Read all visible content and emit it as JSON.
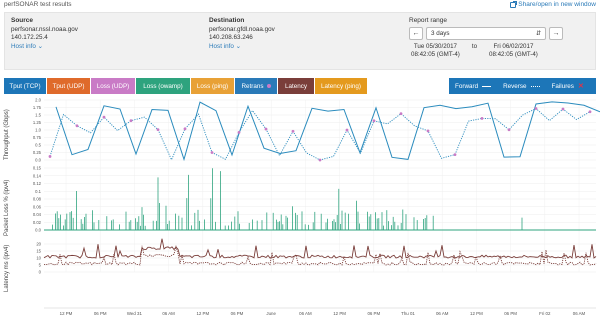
{
  "header": {
    "title": "perfSONAR test results",
    "share_label": "Share/open in new window"
  },
  "source": {
    "heading": "Source",
    "hostname": "perfsonar.nssl.noaa.gov",
    "ip": "140.172.25.4",
    "info_link": "Host info ⌄"
  },
  "destination": {
    "heading": "Destination",
    "hostname": "perfsonar.gfdl.noaa.gov",
    "ip": "140.208.63.246",
    "info_link": "Host info ⌄"
  },
  "report_range": {
    "heading": "Report range",
    "selected": "3 days",
    "prev_icon": "arrow-left-icon",
    "next_icon": "arrow-right-icon",
    "start_line1": "Tue 05/30/2017",
    "start_line2": "08:42:05 (GMT-4)",
    "to_label": "to",
    "end_line1": "Fri 06/02/2017",
    "end_line2": "08:42:05 (GMT-4)"
  },
  "legend": {
    "buttons": [
      {
        "label": "Tput (TCP)",
        "color": "#1d76b8"
      },
      {
        "label": "Tput (UDP)",
        "color": "#df6a2b"
      },
      {
        "label": "Loss (UDP)",
        "color": "#c97bc6"
      },
      {
        "label": "Loss (owamp)",
        "color": "#2ea37e"
      },
      {
        "label": "Loss (ping)",
        "color": "#e8a136"
      },
      {
        "label": "Retrans",
        "color": "#2a7ab8"
      },
      {
        "label": "Latency",
        "color": "#7a3e3a"
      },
      {
        "label": "Latency (ping)",
        "color": "#e49a1e"
      }
    ],
    "direction": {
      "forward": "Forward",
      "reverse": "Reverse",
      "failures": "Failures"
    }
  },
  "panels": {
    "throughput": {
      "label": "Throughput (Gbps)",
      "ticks": [
        "2.0",
        "1.75",
        "1.5",
        "1.25",
        "1.0",
        "0.75",
        "0.5",
        "0.25",
        "0.0"
      ],
      "color": "#2a8bbd"
    },
    "loss": {
      "label": "Packet Loss % (ipv4)",
      "ticks": [
        "0.15",
        "0.14",
        "0.12",
        "0.1",
        "0.08",
        "0.06",
        "0.04",
        "0.02",
        "0.0"
      ],
      "color": "#2ea37e"
    },
    "latency": {
      "label": "Latency ms (ipv4)",
      "ticks": [
        "20",
        "15",
        "10",
        "5",
        "0"
      ],
      "color": "#7a3e3a"
    }
  },
  "x_axis": [
    "12 PM",
    "06 PM",
    "Wed 31",
    "06 AM",
    "12 PM",
    "06 PM",
    "June",
    "06 AM",
    "12 PM",
    "06 PM",
    "Thu 01",
    "06 AM",
    "12 PM",
    "06 PM",
    "Fri 02",
    "06 AM"
  ],
  "colors": {
    "accent": "#1d76b8",
    "retrans_marker": "#c97bc6"
  }
}
